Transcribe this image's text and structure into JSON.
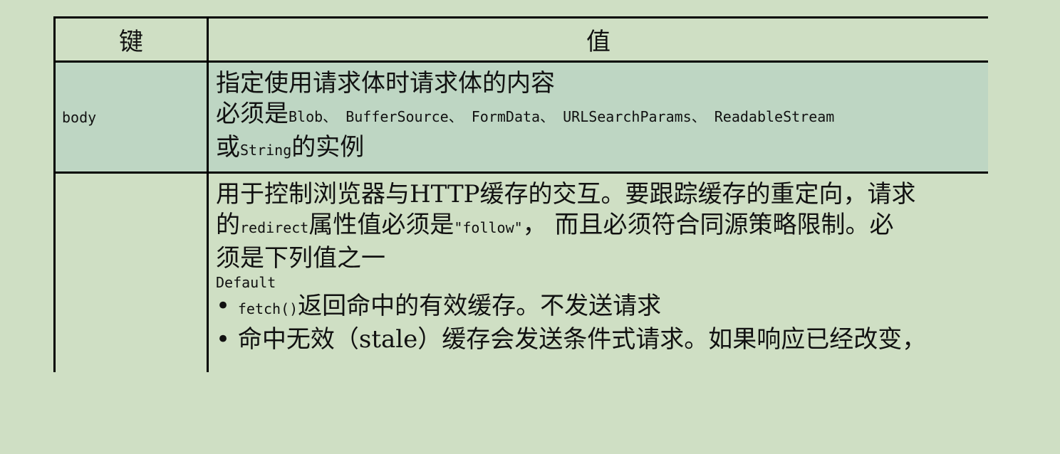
{
  "table": {
    "header": {
      "key": "键",
      "value": "值"
    },
    "rows": [
      {
        "key": "body",
        "value": {
          "line1": "指定使用请求体时请求体的内容",
          "line2_prefix": "必须是",
          "line2_types": "Blob、 BufferSource、 FormData、 URLSearchParams、 ReadableStream",
          "line3_prefix": "或",
          "line3_type": "String",
          "line3_suffix": "的实例"
        }
      },
      {
        "key": "",
        "value": {
          "line1": "用于控制浏览器与HTTP缓存的交互。要跟踪缓存的重定向，请求",
          "line2_a": "的",
          "line2_code1": "redirect",
          "line2_b": "属性值必须是",
          "line2_code2": "\"follow\"",
          "line2_c": "， 而且必须符合同源策略限制。必",
          "line3": "须是下列值之一",
          "option_name": "Default",
          "bullet1_code": "fetch()",
          "bullet1_text": "返回命中的有效缓存。不发送请求",
          "bullet2_text": "命中无效（stale）缓存会发送条件式请求。如果响应已经改变，"
        }
      }
    ]
  }
}
